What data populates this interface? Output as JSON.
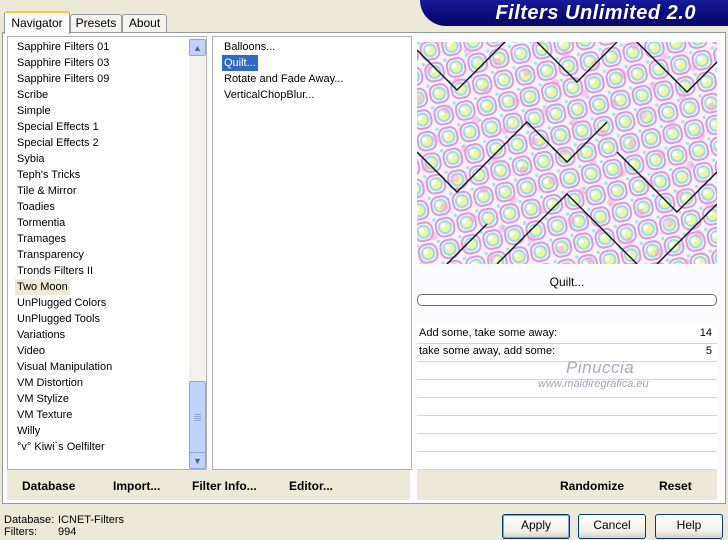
{
  "tabs": [
    "Navigator",
    "Presets",
    "About"
  ],
  "banner_title": "Filters Unlimited 2.0",
  "categories": [
    "Sapphire Filters 01",
    "Sapphire Filters 03",
    "Sapphire Filters 09",
    "Scribe",
    "Simple",
    "Special Effects 1",
    "Special Effects 2",
    "Sybia",
    "Teph's Tricks",
    "Tile & Mirror",
    "Toadies",
    "Tormentia",
    "Tramages",
    "Transparency",
    "Tronds Filters II",
    "Two Moon",
    "UnPlugged Colors",
    "UnPlugged Tools",
    "Variations",
    "Video",
    "Visual Manipulation",
    "VM Distortion",
    "VM Stylize",
    "VM Texture",
    "Willy",
    "°v° Kiwi`s Oelfilter"
  ],
  "selected_category": "Two Moon",
  "filters": [
    "Balloons...",
    "Quilt...",
    "Rotate and Fade Away...",
    "VerticalChopBlur..."
  ],
  "selected_filter": "Quilt...",
  "filter_caption": "Quilt...",
  "params": [
    {
      "label": "Add some, take some away:",
      "value": "14"
    },
    {
      "label": "take some away, add some:",
      "value": "5"
    }
  ],
  "watermark": {
    "name": "Pinuccia",
    "url": "www.maidiregrafica.eu"
  },
  "left_buttons": [
    "Database",
    "Import...",
    "Filter Info...",
    "Editor..."
  ],
  "right_buttons": [
    "Randomize",
    "Reset"
  ],
  "status": {
    "db_label": "Database:",
    "db_value": "ICNET-Filters",
    "f_label": "Filters:",
    "f_value": "994"
  },
  "dialog_buttons": [
    "Apply",
    "Cancel",
    "Help"
  ]
}
